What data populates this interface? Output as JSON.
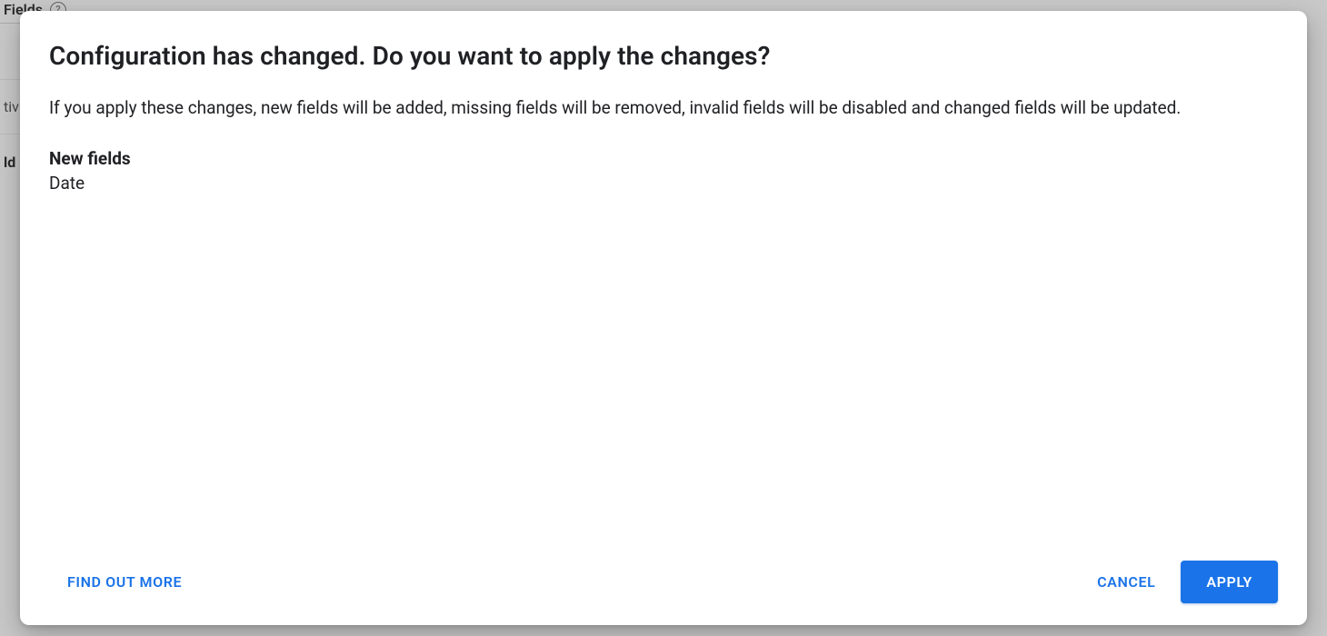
{
  "background": {
    "header_fragment": "Fields",
    "row1_fragment": "tiv",
    "row2_fragment": "ld"
  },
  "dialog": {
    "title": "Configuration has changed. Do you want to apply the changes?",
    "description": "If you apply these changes, new fields will be added, missing fields will be removed, invalid fields will be disabled and changed fields will be updated.",
    "section_new_fields_heading": "New fields",
    "new_fields": [
      "Date"
    ],
    "actions": {
      "find_out_more": "FIND OUT MORE",
      "cancel": "CANCEL",
      "apply": "APPLY"
    }
  }
}
